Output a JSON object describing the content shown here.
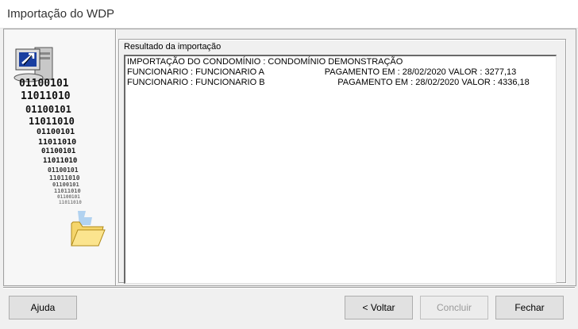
{
  "window": {
    "title": "Importação do WDP"
  },
  "group": {
    "label": "Resultado da importação"
  },
  "result_lines": [
    "IMPORTAÇÃO DO CONDOMÍNIO : CONDOMÍNIO DEMONSTRAÇÃO",
    "FUNCIONARIO : FUNCIONARIO A                         PAGAMENTO EM : 28/02/2020 VALOR : 3277,13",
    "FUNCIONARIO : FUNCIONARIO B                              PAGAMENTO EM : 28/02/2020 VALOR : 4336,18"
  ],
  "buttons": {
    "help": "Ajuda",
    "back": "< Voltar",
    "finish": "Concluir",
    "close": "Fechar"
  },
  "side_art": {
    "binary": [
      "01100101",
      "11011010",
      "01100101",
      "11011010",
      "01100101",
      "11011010",
      "01100101",
      "11011010",
      "01100101",
      "11011010",
      "01100101",
      "11011010",
      "01100101",
      "11011010"
    ]
  }
}
